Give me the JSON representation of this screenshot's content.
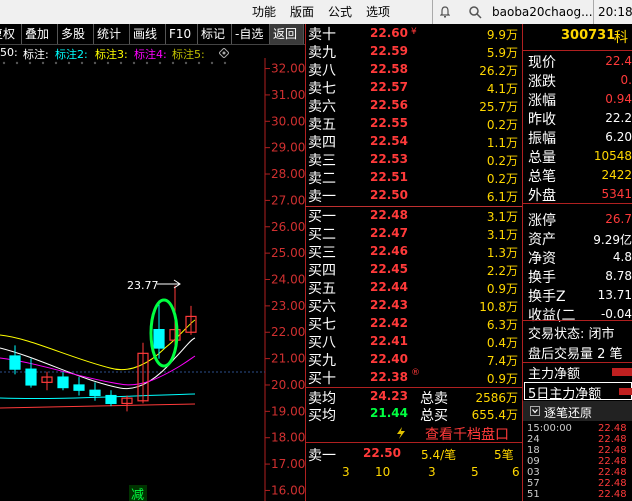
{
  "menubar": {
    "items": [
      "功能",
      "版面",
      "公式",
      "选项"
    ],
    "account": "baoba20chaog...",
    "clock": "20:18"
  },
  "toolbar": {
    "buttons": [
      "复权",
      "叠加",
      "多股",
      "统计",
      "画线",
      "F10",
      "标记",
      "-自选",
      "返回"
    ]
  },
  "indicators": {
    "first": "50:",
    "labels": [
      "标注:",
      "标注2:",
      "标注3:",
      "标注4:",
      "标注5:"
    ],
    "colors": [
      "#ffffff",
      "#00ffff",
      "#ffff00",
      "#ff00ff",
      "#c0c000"
    ]
  },
  "chart": {
    "y_ticks": [
      "32.00",
      "31.00",
      "30.00",
      "29.00",
      "28.00",
      "27.00",
      "26.00",
      "25.00",
      "24.00",
      "23.00",
      "22.00",
      "21.00",
      "20.00",
      "19.00",
      "18.00",
      "17.00",
      "16.00"
    ],
    "peak_label": "23.77",
    "bottom_marker": "减"
  },
  "chart_data": {
    "type": "candlestick",
    "y_range": [
      15.6,
      32.4
    ],
    "candles": [
      {
        "o": 21.1,
        "h": 21.5,
        "l": 20.4,
        "c": 20.6,
        "color": "#00ffff"
      },
      {
        "o": 20.6,
        "h": 21.0,
        "l": 19.9,
        "c": 20.0,
        "color": "#00ffff"
      },
      {
        "o": 20.1,
        "h": 20.5,
        "l": 19.8,
        "c": 20.3,
        "color": "#ff3a3a"
      },
      {
        "o": 20.3,
        "h": 20.5,
        "l": 19.8,
        "c": 19.9,
        "color": "#00ffff"
      },
      {
        "o": 20.0,
        "h": 20.3,
        "l": 19.6,
        "c": 19.8,
        "color": "#00ffff"
      },
      {
        "o": 19.8,
        "h": 20.1,
        "l": 19.4,
        "c": 19.6,
        "color": "#00ffff"
      },
      {
        "o": 19.6,
        "h": 19.8,
        "l": 19.2,
        "c": 19.3,
        "color": "#00ffff"
      },
      {
        "o": 19.3,
        "h": 19.6,
        "l": 19.0,
        "c": 19.5,
        "color": "#ff3a3a"
      },
      {
        "o": 19.4,
        "h": 21.6,
        "l": 19.3,
        "c": 21.2,
        "color": "#ff3a3a"
      },
      {
        "o": 22.1,
        "h": 23.2,
        "l": 21.0,
        "c": 21.4,
        "color": "#00ffff"
      },
      {
        "o": 21.7,
        "h": 23.77,
        "l": 21.2,
        "c": 22.1,
        "color": "#ff3a3a"
      },
      {
        "o": 22.0,
        "h": 23.0,
        "l": 21.9,
        "c": 22.6,
        "color": "#ff3a3a"
      }
    ]
  },
  "orderbook": {
    "sell": [
      {
        "label": "卖十",
        "price": "22.60",
        "vol": "9.9万"
      },
      {
        "label": "卖九",
        "price": "22.59",
        "vol": "5.9万"
      },
      {
        "label": "卖八",
        "price": "22.58",
        "vol": "26.2万"
      },
      {
        "label": "卖七",
        "price": "22.57",
        "vol": "4.1万"
      },
      {
        "label": "卖六",
        "price": "22.56",
        "vol": "25.7万"
      },
      {
        "label": "卖五",
        "price": "22.55",
        "vol": "0.2万"
      },
      {
        "label": "卖四",
        "price": "22.54",
        "vol": "1.1万"
      },
      {
        "label": "卖三",
        "price": "22.53",
        "vol": "0.2万"
      },
      {
        "label": "卖二",
        "price": "22.51",
        "vol": "0.2万"
      },
      {
        "label": "卖一",
        "price": "22.50",
        "vol": "6.1万"
      }
    ],
    "buy": [
      {
        "label": "买一",
        "price": "22.48",
        "vol": "3.1万"
      },
      {
        "label": "买二",
        "price": "22.47",
        "vol": "3.1万"
      },
      {
        "label": "买三",
        "price": "22.46",
        "vol": "1.3万"
      },
      {
        "label": "买四",
        "price": "22.45",
        "vol": "2.2万"
      },
      {
        "label": "买五",
        "price": "22.44",
        "vol": "0.9万"
      },
      {
        "label": "买六",
        "price": "22.43",
        "vol": "10.8万"
      },
      {
        "label": "买七",
        "price": "22.42",
        "vol": "6.3万"
      },
      {
        "label": "买八",
        "price": "22.41",
        "vol": "0.4万"
      },
      {
        "label": "买九",
        "price": "22.40",
        "vol": "7.4万"
      },
      {
        "label": "买十",
        "price": "22.38",
        "vol": "0.9万"
      }
    ],
    "sell_mark": "¥",
    "buy_mark": "®",
    "avg_sell": {
      "label": "卖均",
      "price": "24.23",
      "total_label": "总卖",
      "total": "2586万"
    },
    "avg_buy": {
      "label": "买均",
      "price": "21.44",
      "total_label": "总买",
      "total": "655.4万"
    },
    "view_link": "查看千档盘口",
    "trade": {
      "label": "卖一",
      "price": "22.50",
      "lots": "5.4/笔",
      "count": "5笔"
    },
    "queue": [
      "3",
      "10",
      "3",
      "5",
      "6"
    ]
  },
  "quote": {
    "code": "300731",
    "name": "科",
    "rows": [
      {
        "label": "现价",
        "value": "22.4",
        "color": "#ff3a3a"
      },
      {
        "label": "涨跌",
        "value": "0.",
        "color": "#ff3a3a"
      },
      {
        "label": "涨幅",
        "value": "0.94",
        "color": "#ff3a3a"
      },
      {
        "label": "昨收",
        "value": "22.2",
        "color": "#ffffff"
      },
      {
        "label": "振幅",
        "value": "6.20",
        "color": "#ffffff"
      },
      {
        "label": "总量",
        "value": "10548",
        "color": "#ffd700"
      },
      {
        "label": "总笔",
        "value": "2422",
        "color": "#ffd700"
      },
      {
        "label": "外盘",
        "value": "5341",
        "color": "#ff3a3a"
      },
      {
        "label": "涨停",
        "value": "26.7",
        "color": "#ff3a3a"
      },
      {
        "label": "资产",
        "value": "9.29亿",
        "color": "#ffffff"
      },
      {
        "label": "净资",
        "value": "4.8",
        "color": "#ffffff"
      },
      {
        "label": "换手",
        "value": "8.78",
        "color": "#ffffff"
      },
      {
        "label": "换手Z",
        "value": "13.71",
        "color": "#ffffff"
      },
      {
        "label": "收益(二",
        "value": "-0.04",
        "color": "#ffffff"
      }
    ],
    "trade_status": "交易状态: 闭市",
    "after_hours": "盘后交易量 2 笔",
    "main_net": "主力净额",
    "main_net_5d": "5日主力净额",
    "tick_title": "逐笔还原",
    "ticks": [
      {
        "time": "15:00:00",
        "price": "22.48"
      },
      {
        "time": "24",
        "price": "22.48"
      },
      {
        "time": "18",
        "price": "22.48"
      },
      {
        "time": "09",
        "price": "22.48"
      },
      {
        "time": "03",
        "price": "22.48"
      },
      {
        "time": "57",
        "price": "22.48"
      },
      {
        "time": "51",
        "price": "22.48"
      }
    ]
  }
}
